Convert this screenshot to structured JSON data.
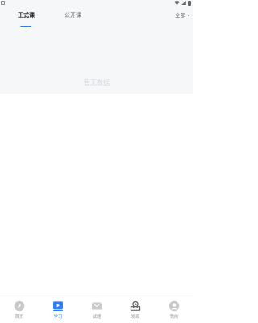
{
  "tabs": {
    "formal_label": "正式课",
    "public_label": "公开课",
    "filter_label": "全部"
  },
  "content": {
    "empty_text": "暂无数据"
  },
  "nav": {
    "items": [
      {
        "label": "首页",
        "icon": "compass-icon"
      },
      {
        "label": "学习",
        "icon": "video-book-icon"
      },
      {
        "label": "试题",
        "icon": "mail-icon"
      },
      {
        "label": "发现",
        "icon": "tray-icon"
      },
      {
        "label": "我的",
        "icon": "user-icon"
      }
    ],
    "active_index": 1,
    "active_color": "#2f7cf6",
    "inactive_color": "#c9c9c9"
  }
}
